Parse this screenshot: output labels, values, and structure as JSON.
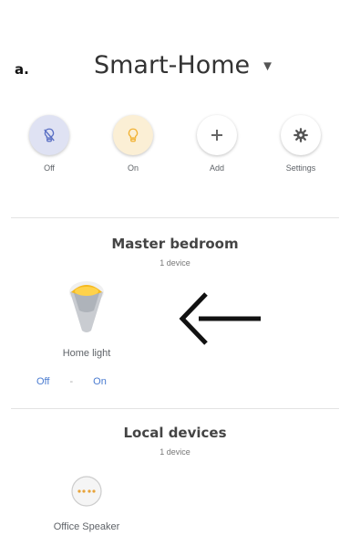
{
  "figure_label": "a.",
  "header": {
    "title": "Smart-Home",
    "caret_icon": "chevron-down-icon"
  },
  "chips": [
    {
      "label": "Off",
      "icon": "bulb-off-icon",
      "color": "#5a6fc4"
    },
    {
      "label": "On",
      "icon": "bulb-on-icon",
      "color": "#f2b233"
    },
    {
      "label": "Add",
      "icon": "plus-icon",
      "color": "#666666"
    },
    {
      "label": "Settings",
      "icon": "gear-icon",
      "color": "#555555"
    }
  ],
  "rooms": [
    {
      "title": "Master bedroom",
      "count": "1 device",
      "device": {
        "name": "Home light",
        "icon": "light-bulb-icon"
      },
      "controls": {
        "off": "Off",
        "separator": "-",
        "on": "On"
      }
    },
    {
      "title": "Local devices",
      "count": "1 device",
      "device": {
        "name": "Office Speaker",
        "icon": "speaker-icon"
      }
    }
  ],
  "annotation": {
    "icon": "arrow-left-icon"
  }
}
